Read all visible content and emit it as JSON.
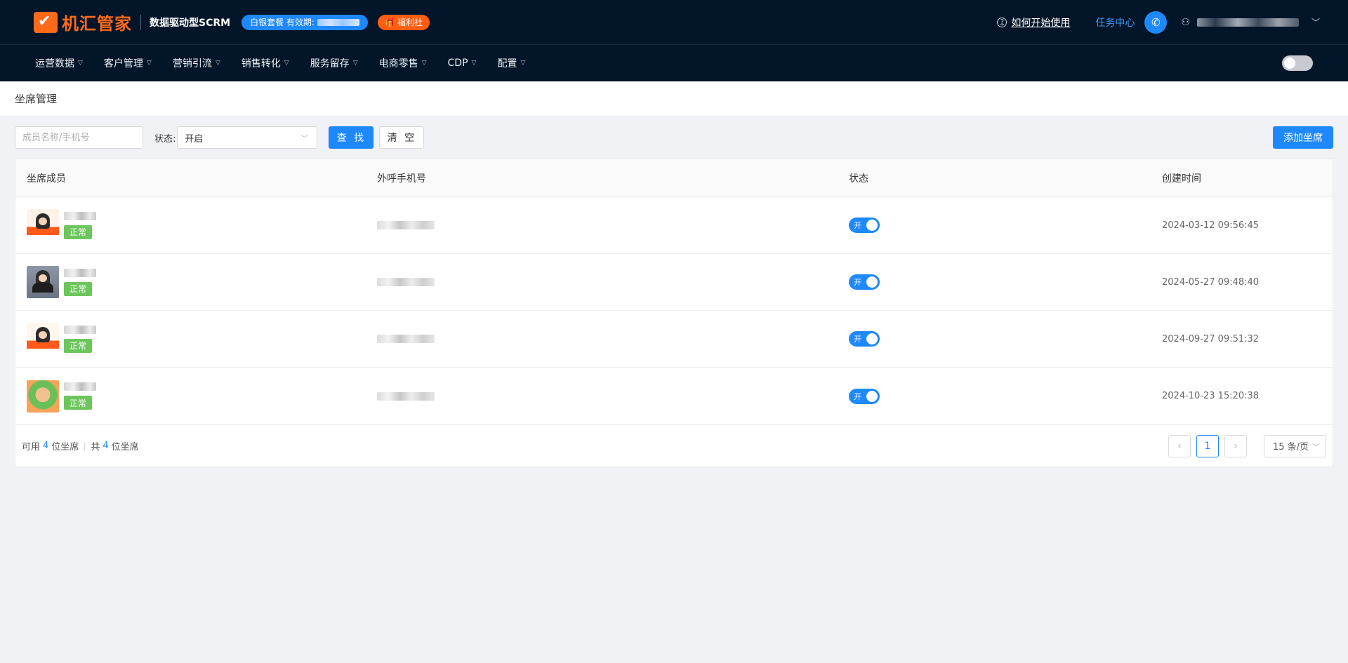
{
  "header": {
    "logo": "机汇管家",
    "slogan": "数据驱动型SCRM",
    "package_label": "白银套餐  有效期:",
    "benefit_label": "福利社",
    "help_link": "如何开始使用",
    "task_center": "任务中心"
  },
  "nav": {
    "items": [
      "运营数据",
      "客户管理",
      "营销引流",
      "销售转化",
      "服务留存",
      "电商零售",
      "CDP",
      "配置"
    ]
  },
  "breadcrumb": "坐席管理",
  "filter": {
    "search_placeholder": "成员名称/手机号",
    "status_label": "状态:",
    "status_value": "开启",
    "search_button": "查 找",
    "clear_button": "清 空",
    "add_button": "添加坐席"
  },
  "table": {
    "columns": [
      "坐席成员",
      "外呼手机号",
      "状态",
      "创建时间"
    ],
    "rows": [
      {
        "tag": "正常",
        "switch": "开",
        "created": "2024-03-12 09:56:45"
      },
      {
        "tag": "正常",
        "switch": "开",
        "created": "2024-05-27 09:48:40"
      },
      {
        "tag": "正常",
        "switch": "开",
        "created": "2024-09-27 09:51:32"
      },
      {
        "tag": "正常",
        "switch": "开",
        "created": "2024-10-23 15:20:38"
      }
    ]
  },
  "footer": {
    "available_prefix": "可用",
    "available_count": "4",
    "available_suffix": "位坐席",
    "total_prefix": "共",
    "total_count": "4",
    "total_suffix": "位坐席",
    "current_page": "1",
    "page_size": "15 条/页"
  },
  "colors": {
    "header_bg": "#031529",
    "primary": "#1e88ff",
    "brand_orange": "#ff6a1a",
    "tag_green": "#6cc65b"
  }
}
